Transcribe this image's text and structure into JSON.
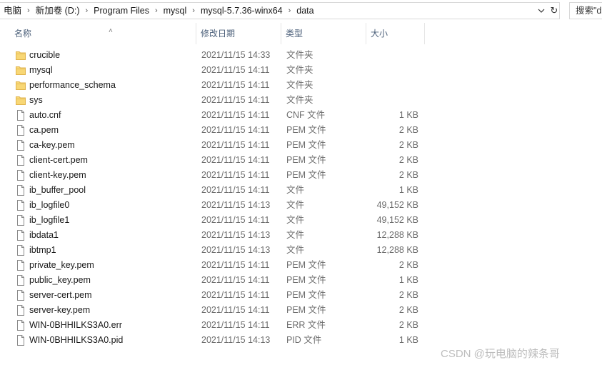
{
  "address_bar": {
    "crumbs": [
      "电脑",
      "新加卷 (D:)",
      "Program Files",
      "mysql",
      "mysql-5.7.36-winx64",
      "data"
    ],
    "search_placeholder": "搜索\"d"
  },
  "columns": {
    "name": "名称",
    "date": "修改日期",
    "type": "类型",
    "size": "大小"
  },
  "files": [
    {
      "name": "crucible",
      "date": "2021/11/15 14:33",
      "type": "文件夹",
      "size": "",
      "kind": "folder"
    },
    {
      "name": "mysql",
      "date": "2021/11/15 14:11",
      "type": "文件夹",
      "size": "",
      "kind": "folder"
    },
    {
      "name": "performance_schema",
      "date": "2021/11/15 14:11",
      "type": "文件夹",
      "size": "",
      "kind": "folder"
    },
    {
      "name": "sys",
      "date": "2021/11/15 14:11",
      "type": "文件夹",
      "size": "",
      "kind": "folder"
    },
    {
      "name": "auto.cnf",
      "date": "2021/11/15 14:11",
      "type": "CNF 文件",
      "size": "1 KB",
      "kind": "file"
    },
    {
      "name": "ca.pem",
      "date": "2021/11/15 14:11",
      "type": "PEM 文件",
      "size": "2 KB",
      "kind": "file"
    },
    {
      "name": "ca-key.pem",
      "date": "2021/11/15 14:11",
      "type": "PEM 文件",
      "size": "2 KB",
      "kind": "file"
    },
    {
      "name": "client-cert.pem",
      "date": "2021/11/15 14:11",
      "type": "PEM 文件",
      "size": "2 KB",
      "kind": "file"
    },
    {
      "name": "client-key.pem",
      "date": "2021/11/15 14:11",
      "type": "PEM 文件",
      "size": "2 KB",
      "kind": "file"
    },
    {
      "name": "ib_buffer_pool",
      "date": "2021/11/15 14:11",
      "type": "文件",
      "size": "1 KB",
      "kind": "file"
    },
    {
      "name": "ib_logfile0",
      "date": "2021/11/15 14:13",
      "type": "文件",
      "size": "49,152 KB",
      "kind": "file"
    },
    {
      "name": "ib_logfile1",
      "date": "2021/11/15 14:11",
      "type": "文件",
      "size": "49,152 KB",
      "kind": "file"
    },
    {
      "name": "ibdata1",
      "date": "2021/11/15 14:13",
      "type": "文件",
      "size": "12,288 KB",
      "kind": "file"
    },
    {
      "name": "ibtmp1",
      "date": "2021/11/15 14:13",
      "type": "文件",
      "size": "12,288 KB",
      "kind": "file"
    },
    {
      "name": "private_key.pem",
      "date": "2021/11/15 14:11",
      "type": "PEM 文件",
      "size": "2 KB",
      "kind": "file"
    },
    {
      "name": "public_key.pem",
      "date": "2021/11/15 14:11",
      "type": "PEM 文件",
      "size": "1 KB",
      "kind": "file"
    },
    {
      "name": "server-cert.pem",
      "date": "2021/11/15 14:11",
      "type": "PEM 文件",
      "size": "2 KB",
      "kind": "file"
    },
    {
      "name": "server-key.pem",
      "date": "2021/11/15 14:11",
      "type": "PEM 文件",
      "size": "2 KB",
      "kind": "file"
    },
    {
      "name": "WIN-0BHHILKS3A0.err",
      "date": "2021/11/15 14:11",
      "type": "ERR 文件",
      "size": "2 KB",
      "kind": "file"
    },
    {
      "name": "WIN-0BHHILKS3A0.pid",
      "date": "2021/11/15 14:13",
      "type": "PID 文件",
      "size": "1 KB",
      "kind": "file"
    }
  ],
  "watermark": "CSDN @玩电脑的辣条哥",
  "colors": {
    "folder": "#f8d775",
    "folder_dark": "#e0b34c",
    "header_text": "#4c607a"
  },
  "icons": {
    "folder": "folder-icon",
    "file": "file-icon",
    "dropdown": "chevron-down-icon",
    "refresh": "refresh-icon",
    "sort": "sort-up-icon",
    "separator": "chevron-right-icon"
  }
}
